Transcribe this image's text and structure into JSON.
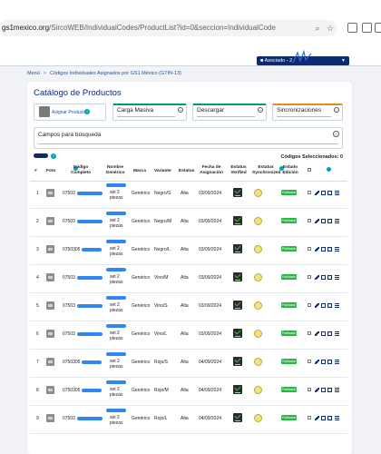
{
  "browser": {
    "url_host": "gs1mexico.org",
    "url_path": "/SircoWEB/IndividualCodes/ProductList?id=0&seccion=IndividualCode"
  },
  "header": {
    "user_label": "Asociado - 2"
  },
  "breadcrumb": [
    "Menú",
    "Códigos Individuales Asignados por GS1 México (GTIN-13)"
  ],
  "page": {
    "title": "Catálogo de Productos",
    "cards": [
      {
        "label": "Asignar Producto",
        "icon": "box-icon"
      },
      {
        "label": "Carga Masiva",
        "icon": "info-circle-icon"
      },
      {
        "label": "Descargar",
        "icon": "info-circle-icon"
      },
      {
        "label": "Sincronizaciones",
        "icon": "info-circle-icon"
      }
    ],
    "search_label": "Campos para búsqueda",
    "selected_count_label": "Códigos Seleccionados: 0",
    "accent": "#0b2a6f",
    "badge_color": "#2bb24c"
  },
  "table": {
    "headers": [
      "#",
      "Foto",
      "Código Completo",
      "Nombre Genérico",
      "Marca",
      "Variante",
      "Estatus",
      "Fecha de Asignación",
      "Estatus Verified",
      "Estatus Synchronized",
      "Estado Edición"
    ],
    "rows": [
      {
        "n": "1",
        "code": "07503",
        "name": "set 2 piezas",
        "marca": "Genérico",
        "variante": "Negro/S",
        "estatus": "Alta",
        "fecha": "03/09/2024",
        "edicion": "Publicado"
      },
      {
        "n": "2",
        "code": "07503",
        "name": "set 2 piezas",
        "marca": "Genérico",
        "variante": "Negro/M",
        "estatus": "Alta",
        "fecha": "03/09/2024",
        "edicion": "Publicado"
      },
      {
        "n": "3",
        "code": "0750305",
        "name": "set 2 piezas",
        "marca": "Genérico",
        "variante": "Negro/L",
        "estatus": "Alta",
        "fecha": "03/09/2024",
        "edicion": "Publicado"
      },
      {
        "n": "4",
        "code": "07503",
        "name": "set 2 piezas",
        "marca": "Genérico",
        "variante": "Vino/M",
        "estatus": "Alta",
        "fecha": "03/09/2024",
        "edicion": "Publicado"
      },
      {
        "n": "5",
        "code": "07503",
        "name": "set 2 piezas",
        "marca": "Genérico",
        "variante": "Vino/S",
        "estatus": "Alta",
        "fecha": "03/09/2024",
        "edicion": "Publicado"
      },
      {
        "n": "6",
        "code": "07503",
        "name": "set 2 piezas",
        "marca": "Genérico",
        "variante": "Vino/L",
        "estatus": "Alta",
        "fecha": "03/09/2024",
        "edicion": "Publicado"
      },
      {
        "n": "7",
        "code": "0750305",
        "name": "set 2 piezas",
        "marca": "Genérico",
        "variante": "Rojo/S",
        "estatus": "Alta",
        "fecha": "04/09/2024",
        "edicion": "Publicado"
      },
      {
        "n": "8",
        "code": "0750305",
        "name": "set 2 piezas",
        "marca": "Genérico",
        "variante": "Rojo/M",
        "estatus": "Alta",
        "fecha": "04/09/2024",
        "edicion": "Publicado"
      },
      {
        "n": "9",
        "code": "07503",
        "name": "set 2 piezas",
        "marca": "Genérico",
        "variante": "Rojo/L",
        "estatus": "Alta",
        "fecha": "04/09/2024",
        "edicion": "Publicado"
      }
    ]
  }
}
